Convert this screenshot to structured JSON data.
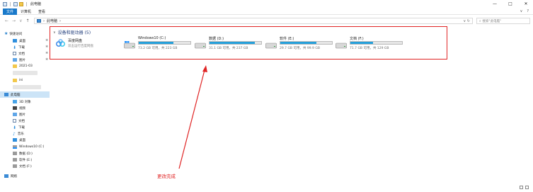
{
  "window": {
    "title": "此电脑",
    "controls": [
      "—",
      "□",
      "✕"
    ]
  },
  "ribbon": {
    "tabs": [
      "文件",
      "计算机",
      "查看"
    ],
    "right_icons": [
      "∨",
      "?"
    ]
  },
  "address": {
    "back": "←",
    "forward": "→",
    "dropdown": "∨",
    "up": "↑",
    "path_chevron": "›",
    "path": "此电脑",
    "path_end_chevron": "›",
    "refresh": "∨  ↻",
    "search_placeholder": "搜索\"此电脑\""
  },
  "sidebar": {
    "quick_access": "快速访问",
    "items": [
      {
        "label": "桌面",
        "icon": "desktop-icon",
        "pinned": true
      },
      {
        "label": "下载",
        "icon": "download-icon",
        "pinned": true
      },
      {
        "label": "文档",
        "icon": "document-icon",
        "pinned": true
      },
      {
        "label": "图片",
        "icon": "picture-icon",
        "pinned": true
      },
      {
        "label": "2021-03",
        "icon": "folder-icon",
        "pinned": false
      },
      {
        "label": "ini",
        "icon": "folder-icon",
        "pinned": false
      }
    ],
    "this_pc": "此电脑",
    "pc_items": [
      {
        "label": "3D 对象",
        "icon": "3d-objects-icon"
      },
      {
        "label": "视频",
        "icon": "video-icon"
      },
      {
        "label": "图片",
        "icon": "picture-icon"
      },
      {
        "label": "文档",
        "icon": "document-icon"
      },
      {
        "label": "下载",
        "icon": "download-icon"
      },
      {
        "label": "音乐",
        "icon": "music-icon"
      },
      {
        "label": "桌面",
        "icon": "desktop-icon"
      },
      {
        "label": "Windows10 (C:)",
        "icon": "windows-drive-icon"
      },
      {
        "label": "数据 (D:)",
        "icon": "drive-icon"
      },
      {
        "label": "软件 (E:)",
        "icon": "drive-icon"
      },
      {
        "label": "文档 (F:)",
        "icon": "drive-icon"
      }
    ],
    "network": "网络",
    "pin_glyph": "✱"
  },
  "main": {
    "group_chevron": "∨",
    "group_title": "设备和驱动器 (5)",
    "cloud": {
      "name": "百度网盘",
      "subtitle": "双击运行百度网盘"
    },
    "drives": [
      {
        "name": "Windows10 (C:)",
        "free": "73.2 GB 可用，共 223 GB",
        "used_fraction": 0.67,
        "icon": "windows-drive-icon"
      },
      {
        "name": "数据 (D:)",
        "free": "31.1 GB 可用，共 237 GB",
        "used_fraction": 0.87,
        "icon": "drive-icon"
      },
      {
        "name": "软件 (E:)",
        "free": "29.7 GB 可用，共 99.9 GB",
        "used_fraction": 0.7,
        "icon": "drive-icon"
      },
      {
        "name": "文档 (F:)",
        "free": "71.7 GB 可用，共 129 GB",
        "used_fraction": 0.44,
        "icon": "drive-icon"
      }
    ]
  },
  "annotation": {
    "text": "更改完成",
    "color": "#e02424"
  },
  "colors": {
    "accent": "#1979ca",
    "bar_fill": "#26a0da",
    "highlight": "#e02424",
    "selected": "#cce4f7"
  }
}
